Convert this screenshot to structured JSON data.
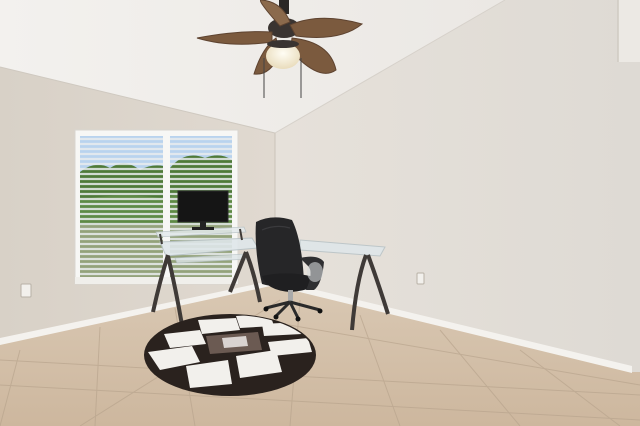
{
  "scene": {
    "kind": "interior-photo",
    "colors": {
      "ceiling": "#f1efec",
      "left_wall": "#dcd5cc",
      "right_wall": "#e4dfd8",
      "floor": "#d2bea6",
      "grout": "#b9a58e",
      "baseboard": "#f4f2ee",
      "window_frame": "#f7f7f5",
      "blinds": "#dfe3e6",
      "sky": "#b9d3ee",
      "trees": "#4e7a38",
      "fan_blade": "#7b5a3e",
      "glass_desk": "#dfe7ea",
      "desk_leg": "#3f3a37",
      "chair": "#262628",
      "rug_dark": "#2a221e",
      "rug_light": "#f2f0ec",
      "monitor": "#151515"
    },
    "objects": [
      "ceiling-fan",
      "window-with-blinds",
      "glass-desk",
      "monitor",
      "office-chair",
      "round-rug",
      "power-outlet"
    ]
  }
}
